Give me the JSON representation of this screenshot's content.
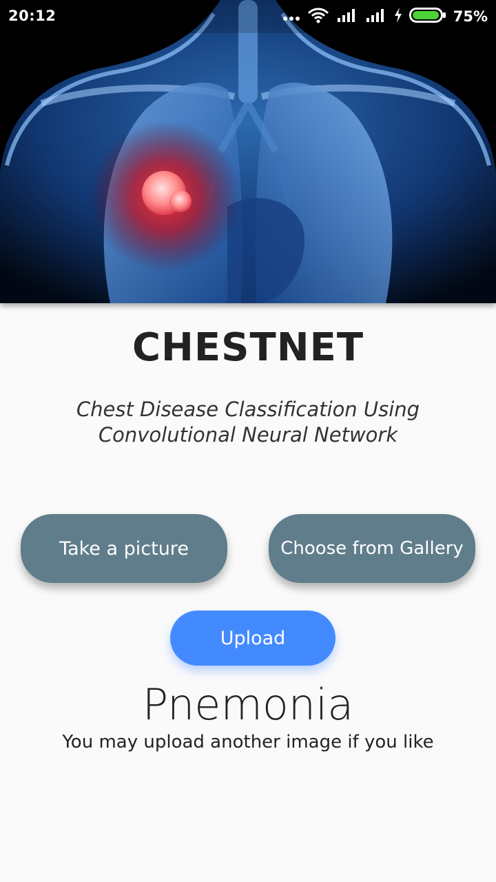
{
  "status_bar": {
    "time": "20:12",
    "battery_percent": "75%",
    "icons": [
      "more-dots-icon",
      "wifi-icon",
      "signal-icon",
      "signal-icon",
      "charging-icon",
      "battery-icon"
    ]
  },
  "hero": {
    "image": "chest-xray-lungs-image"
  },
  "app": {
    "title": "CHESTNET",
    "subtitle": "Chest Disease Classification Using Convolutional Neural Network"
  },
  "actions": {
    "take_picture": "Take a picture",
    "choose_gallery": "Choose from Gallery",
    "upload": "Upload"
  },
  "result": {
    "label": "Pnemonia",
    "hint": "You may upload another image if you like"
  },
  "colors": {
    "button_grey": "#607d8b",
    "button_blue": "#448aff",
    "background": "#fafafa"
  }
}
